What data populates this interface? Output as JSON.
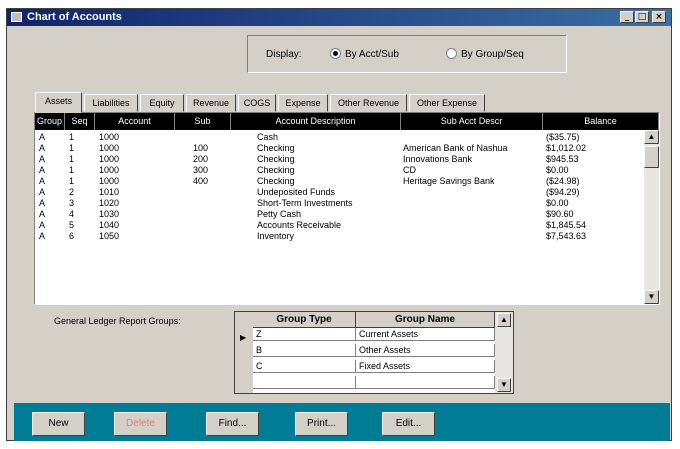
{
  "window": {
    "title": "Chart of Accounts",
    "controls": [
      "_",
      "□",
      "×"
    ]
  },
  "display": {
    "label": "Display:",
    "options": [
      {
        "label": "By Acct/Sub",
        "selected": true
      },
      {
        "label": "By Group/Seq",
        "selected": false
      }
    ]
  },
  "tabs": [
    "Assets",
    "Liabilities",
    "Equity",
    "Revenue",
    "COGS",
    "Expense",
    "Other Revenue",
    "Other Expense"
  ],
  "active_tab": "Assets",
  "accounts_table": {
    "columns": [
      "Group",
      "Seq",
      "Account",
      "Sub",
      "Account Description",
      "Sub Acct Descr",
      "Balance"
    ],
    "rows": [
      [
        "A",
        "1",
        "1000",
        "",
        "Cash",
        "",
        "($35.75)"
      ],
      [
        "A",
        "1",
        "1000",
        "100",
        "Checking",
        "American Bank of Nashua",
        "$1,012.02"
      ],
      [
        "A",
        "1",
        "1000",
        "200",
        "Checking",
        "Innovations Bank",
        "$945.53"
      ],
      [
        "A",
        "1",
        "1000",
        "300",
        "Checking",
        "CD",
        "$0.00"
      ],
      [
        "A",
        "1",
        "1000",
        "400",
        "Checking",
        "Heritage Savings Bank",
        "($24.98)"
      ],
      [
        "A",
        "2",
        "1010",
        "",
        "Undeposited Funds",
        "",
        "($94.29)"
      ],
      [
        "A",
        "3",
        "1020",
        "",
        "Short-Term Investments",
        "",
        "$0.00"
      ],
      [
        "A",
        "4",
        "1030",
        "",
        "Petty Cash",
        "",
        "$90.60"
      ],
      [
        "A",
        "5",
        "1040",
        "",
        "Accounts Receivable",
        "",
        "$1,845.54"
      ],
      [
        "A",
        "6",
        "1050",
        "",
        "Inventory",
        "",
        "$7,543.63"
      ]
    ]
  },
  "report_groups": {
    "label": "General Ledger Report Groups:",
    "columns": [
      "Group Type",
      "Group Name"
    ],
    "rows": [
      [
        "Z",
        "Current Assets"
      ],
      [
        "B",
        "Other Assets"
      ],
      [
        "C",
        "Fixed Assets"
      ],
      [
        "",
        ""
      ]
    ]
  },
  "buttons": [
    {
      "label": "New",
      "enabled": true
    },
    {
      "label": "Delete",
      "enabled": false
    },
    {
      "label": "Find...",
      "enabled": true
    },
    {
      "label": "Print...",
      "enabled": true
    },
    {
      "label": "Edit...",
      "enabled": true
    }
  ]
}
